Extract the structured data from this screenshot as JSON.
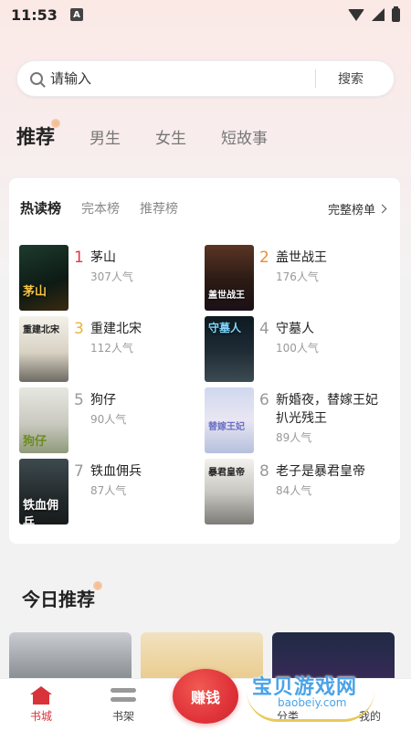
{
  "status_bar": {
    "time": "11:53",
    "notif_glyph": "A"
  },
  "search": {
    "placeholder": "请输入",
    "button_label": "搜索"
  },
  "category_tabs": [
    {
      "label": "推荐",
      "active": true
    },
    {
      "label": "男生",
      "active": false
    },
    {
      "label": "女生",
      "active": false
    },
    {
      "label": "短故事",
      "active": false
    }
  ],
  "ranking": {
    "tabs": [
      {
        "label": "热读榜",
        "active": true
      },
      {
        "label": "完本榜",
        "active": false
      },
      {
        "label": "推荐榜",
        "active": false
      }
    ],
    "full_list_label": "完整榜单",
    "books": [
      {
        "rank": "1",
        "title": "茅山",
        "popularity": "307人气",
        "cover_text": "茅山"
      },
      {
        "rank": "2",
        "title": "盖世战王",
        "popularity": "176人气",
        "cover_text": "盖世战王"
      },
      {
        "rank": "3",
        "title": "重建北宋",
        "popularity": "112人气",
        "cover_text": "重建北宋"
      },
      {
        "rank": "4",
        "title": "守墓人",
        "popularity": "100人气",
        "cover_text": "守墓人"
      },
      {
        "rank": "5",
        "title": "狗仔",
        "popularity": "90人气",
        "cover_text": "狗仔"
      },
      {
        "rank": "6",
        "title": "新婚夜，替嫁王妃扒光残王",
        "popularity": "89人气",
        "cover_text": "替嫁王妃"
      },
      {
        "rank": "7",
        "title": "铁血佣兵",
        "popularity": "87人气",
        "cover_text": "铁血佣兵"
      },
      {
        "rank": "8",
        "title": "老子是暴君皇帝",
        "popularity": "84人气",
        "cover_text": "暴君皇帝"
      }
    ]
  },
  "today": {
    "title": "今日推荐"
  },
  "bottom_nav": {
    "home": "书城",
    "shelf": "书架",
    "earn": "赚钱",
    "category": "分类",
    "mine": "我的"
  },
  "watermark": {
    "text": "宝贝游戏网",
    "url": "baobeiy.com"
  },
  "colors": {
    "accent": "#d9333a",
    "rank1": "#e0393e",
    "rank2": "#f08b34",
    "rank3": "#e9b339"
  }
}
